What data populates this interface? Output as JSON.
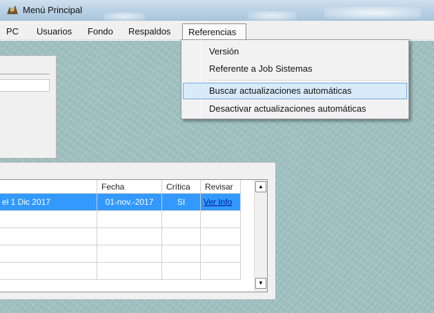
{
  "window": {
    "title": "Menú Principal"
  },
  "menubar": {
    "items": [
      "PC",
      "Usuarios",
      "Fondo",
      "Respaldos",
      "Referencias"
    ]
  },
  "dropdown": {
    "items": [
      "Versión",
      "Referente a Job Sistemas",
      "Buscar actualizaciones automáticas",
      "Desactivar actualizaciones automáticas"
    ],
    "highlighted": "Buscar actualizaciones automáticas"
  },
  "grid": {
    "columns": [
      "",
      "Fecha",
      "Crítica",
      "Revisar"
    ],
    "rows": [
      [
        "el 1 Dic 2017",
        "01-nov.-2017",
        "SI",
        "Ver Info"
      ]
    ],
    "empty_rows": 4
  },
  "colors": {
    "selection": "#3399ff",
    "menu_highlight": "#d9ebfb",
    "desktop": "#9fbfc0",
    "link": "#0000ff"
  }
}
